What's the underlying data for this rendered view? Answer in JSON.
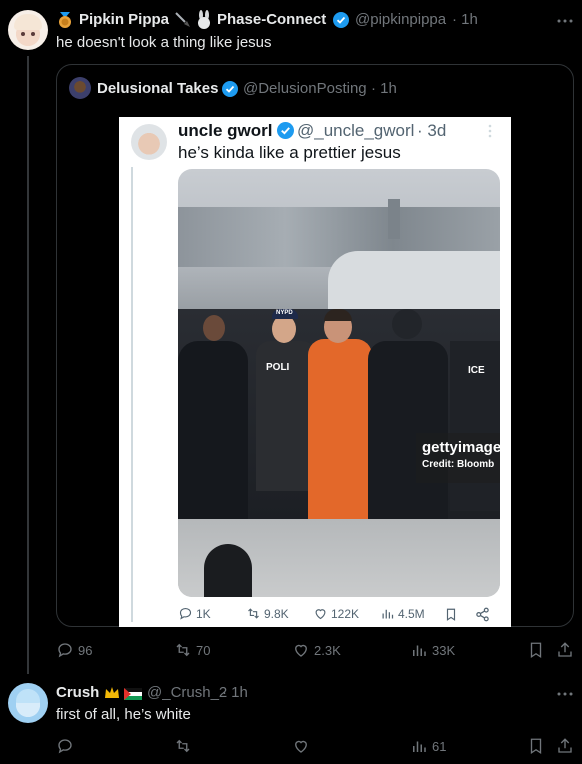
{
  "main_post": {
    "display_name": "Pipkin Pippa",
    "name_suffix": "Phase-Connect",
    "handle": "@pipkinpippa",
    "time": "· 1h",
    "text": "he doesn't look a thing like jesus",
    "icons": [
      "medal-icon",
      "sword-icon",
      "bunny-icon"
    ]
  },
  "quoted_post": {
    "display_name": "Delusional Takes",
    "handle": "@DelusionPosting",
    "time": "· 1h"
  },
  "embedded_tweet": {
    "display_name": "uncle gworl",
    "handle": "@_uncle_gworl",
    "time": "· 3d",
    "text": "he’s kinda like a prettier jesus",
    "photo": {
      "watermark_main": "gettyimage",
      "watermark_credit": "Credit: Bloomb",
      "vest_police": "POLI",
      "vest_ice": "ICE",
      "cap_nypd": "NYPD"
    },
    "metrics": {
      "replies": "1K",
      "reposts": "9.8K",
      "likes": "122K",
      "views": "4.5M"
    }
  },
  "main_actions": {
    "replies": "96",
    "reposts": "70",
    "likes": "2.3K",
    "views": "33K"
  },
  "reply_post": {
    "display_name": "Crush",
    "handle": "@_Crush_2",
    "time": "· 1h",
    "text": "first of all, he’s white",
    "views": "61",
    "icons": [
      "crown-icon",
      "flag-icon"
    ]
  },
  "colors": {
    "background": "#000000",
    "text": "#e7e9ea",
    "muted": "#71767b",
    "verified": "#1d9bf0",
    "border": "#2f3336"
  }
}
